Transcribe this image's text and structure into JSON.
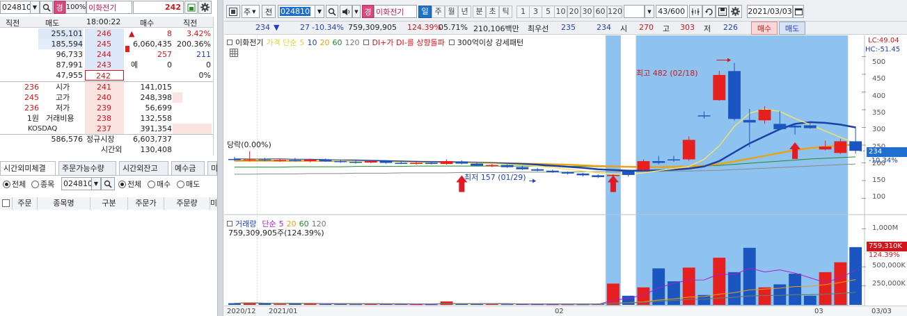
{
  "left_toolbar": {
    "code": "024810",
    "margin_tag": "경",
    "margin_rate": "100%",
    "name": "이화전기",
    "price": "242"
  },
  "orderbook": {
    "headers": [
      "직전",
      "매도",
      "18:00:22",
      "매수",
      "직전"
    ],
    "asks": [
      {
        "prev": "255,101",
        "qty": "255,101",
        "price": "246"
      },
      {
        "prev": "185,594",
        "qty": "185,594",
        "price": "245"
      },
      {
        "prev": "96,733",
        "qty": "96,733",
        "price": "244"
      },
      {
        "prev": "87,991",
        "qty": "87,991",
        "price": "243"
      },
      {
        "prev": "47,955",
        "qty": "47,955",
        "price": "242"
      }
    ],
    "right_info": [
      {
        "a": "▲",
        "b": "8",
        "c": "3.42%"
      },
      {
        "a": "",
        "b": "6,060,435",
        "c": "200.36%"
      },
      {
        "a": "",
        "b": "257",
        "c": "211"
      },
      {
        "a": "예",
        "b": "0",
        "c": "0"
      },
      {
        "a": "",
        "b": "",
        "c": "0%"
      }
    ],
    "bids": [
      {
        "l1": "236",
        "l2": "시가",
        "price": "241",
        "qty": "141,015"
      },
      {
        "l1": "245",
        "l2": "고가",
        "price": "240",
        "qty": "248,398"
      },
      {
        "l1": "236",
        "l2": "저가",
        "price": "239",
        "qty": "56,699"
      },
      {
        "l1": "1원",
        "l2": "거래비용",
        "price": "238",
        "qty": "132,558"
      },
      {
        "l1": "KOSDAQ",
        "l2": "",
        "price": "237",
        "qty": "391,354"
      }
    ],
    "total_ask": "586,576",
    "regular_label": "정규시장",
    "total_bid": "6,603,737",
    "after_label": "시간외",
    "after_qty": "130,408"
  },
  "tabs": [
    "시간외미체결",
    "주문가능수량",
    "시간외잔고",
    "예수금",
    "미"
  ],
  "filter": {
    "opt_all": "전체",
    "opt_stock": "종목",
    "code": "024810",
    "opt_all2": "전체",
    "opt_buy": "매수",
    "opt_sell": "매도"
  },
  "table_headers": [
    "주문",
    "종목명",
    "구분",
    "주문가",
    "주문량",
    "미"
  ],
  "chart_toolbar": {
    "type": "주",
    "prev": "전",
    "code": "024810",
    "margin_tag": "경",
    "name": "이화전기",
    "periods": [
      "일",
      "주",
      "월",
      "년",
      "분",
      "초",
      "틱"
    ],
    "active_period": "일",
    "intervals": [
      "1",
      "3",
      "5",
      "10",
      "20",
      "30",
      "60",
      "120"
    ],
    "count": "43",
    "count_total": "/600",
    "date": "2021/03/03"
  },
  "summary": {
    "price": "234",
    "arrow": "▼",
    "change": "27",
    "change_pct": "-10.34%",
    "volume": "759,309,905",
    "vol_ratio": "124.39%",
    "turnover": "05.71%",
    "amount": "210,106백만",
    "best_label": "최우선",
    "best_ask": "235",
    "best_bid": "234",
    "open_label": "시",
    "open": "270",
    "high_label": "고",
    "high": "303",
    "low_label": "저",
    "low": "226",
    "buy": "매수",
    "sell": "매도"
  },
  "legend": {
    "name": "이화전기",
    "ma_label": "가격 단순",
    "ma_vals": [
      "5",
      "10",
      "20",
      "60",
      "120"
    ],
    "signal": "DI+가 DI-를 상향돌파",
    "pattern": "300억이상 강세패턴"
  },
  "annotations": {
    "upper_limit": "당락(0.00%)",
    "high": "최고 482 (02/18)",
    "low": "최저 157 (01/29)"
  },
  "price_axis": {
    "lc": "LC:49.04",
    "hc": "HC:-51.45",
    "ticks": [
      "500",
      "450",
      "400",
      "350",
      "300",
      "250",
      "200",
      "150",
      "100"
    ],
    "current": "234",
    "current_pct": "-10.34%"
  },
  "volume_legend": {
    "label": "거래량",
    "ma_label": "단순",
    "ma_vals": [
      "5",
      "20",
      "60",
      "120"
    ],
    "info": "759,309,905주(124.39%)"
  },
  "volume_axis": {
    "ticks": [
      "1,000M",
      "500,000K",
      "250,000K"
    ],
    "current": "759,310K",
    "current_pct": "124.39%"
  },
  "x_axis": [
    "2020/12",
    "2021/01",
    "02",
    "03",
    "03/03"
  ],
  "colors": {
    "up": "#e61f1f",
    "down": "#1b56c0",
    "highlight": "#8ec3f0"
  },
  "chart_data": {
    "type": "candlestick",
    "price_ylim": [
      60,
      540
    ],
    "volume_ylim": [
      0,
      1150
    ],
    "candles": [
      {
        "o": 211,
        "h": 217,
        "l": 206,
        "c": 208,
        "v": 22
      },
      {
        "o": 208,
        "h": 233,
        "l": 204,
        "c": 210,
        "v": 30
      },
      {
        "o": 210,
        "h": 214,
        "l": 205,
        "c": 207,
        "v": 18
      },
      {
        "o": 207,
        "h": 211,
        "l": 203,
        "c": 208,
        "v": 12
      },
      {
        "o": 208,
        "h": 214,
        "l": 204,
        "c": 205,
        "v": 14
      },
      {
        "o": 205,
        "h": 212,
        "l": 202,
        "c": 209,
        "v": 20
      },
      {
        "o": 209,
        "h": 212,
        "l": 203,
        "c": 204,
        "v": 10
      },
      {
        "o": 205,
        "h": 208,
        "l": 200,
        "c": 203,
        "v": 9
      },
      {
        "o": 203,
        "h": 206,
        "l": 198,
        "c": 201,
        "v": 8
      },
      {
        "o": 201,
        "h": 207,
        "l": 199,
        "c": 205,
        "v": 12
      },
      {
        "o": 205,
        "h": 208,
        "l": 198,
        "c": 200,
        "v": 10
      },
      {
        "o": 200,
        "h": 205,
        "l": 197,
        "c": 198,
        "v": 9
      },
      {
        "o": 198,
        "h": 202,
        "l": 195,
        "c": 200,
        "v": 8
      },
      {
        "o": 200,
        "h": 204,
        "l": 196,
        "c": 197,
        "v": 7
      },
      {
        "o": 197,
        "h": 210,
        "l": 195,
        "c": 205,
        "v": 45
      },
      {
        "o": 204,
        "h": 207,
        "l": 196,
        "c": 198,
        "v": 12
      },
      {
        "o": 198,
        "h": 201,
        "l": 190,
        "c": 192,
        "v": 10
      },
      {
        "o": 192,
        "h": 197,
        "l": 188,
        "c": 194,
        "v": 9
      },
      {
        "o": 194,
        "h": 196,
        "l": 186,
        "c": 188,
        "v": 8
      },
      {
        "o": 188,
        "h": 191,
        "l": 180,
        "c": 182,
        "v": 9
      },
      {
        "o": 182,
        "h": 186,
        "l": 176,
        "c": 178,
        "v": 8
      },
      {
        "o": 178,
        "h": 181,
        "l": 172,
        "c": 174,
        "v": 7
      },
      {
        "o": 174,
        "h": 176,
        "l": 167,
        "c": 170,
        "v": 7
      },
      {
        "o": 170,
        "h": 172,
        "l": 162,
        "c": 165,
        "v": 7
      },
      {
        "o": 165,
        "h": 168,
        "l": 157,
        "c": 160,
        "v": 8
      },
      {
        "o": 163,
        "h": 168,
        "l": 158,
        "c": 166,
        "v": 280
      },
      {
        "o": 176,
        "h": 181,
        "l": 162,
        "c": 166,
        "v": 120
      },
      {
        "o": 180,
        "h": 210,
        "l": 177,
        "c": 205,
        "v": 230
      },
      {
        "o": 205,
        "h": 220,
        "l": 196,
        "c": 200,
        "v": 480
      },
      {
        "o": 210,
        "h": 220,
        "l": 203,
        "c": 207,
        "v": 310
      },
      {
        "o": 210,
        "h": 275,
        "l": 206,
        "c": 265,
        "v": 490
      },
      {
        "o": 334,
        "h": 345,
        "l": 325,
        "c": 333,
        "v": 130
      },
      {
        "o": 377,
        "h": 460,
        "l": 375,
        "c": 448,
        "v": 620
      },
      {
        "o": 459,
        "h": 482,
        "l": 319,
        "c": 324,
        "v": 430
      },
      {
        "o": 321,
        "h": 352,
        "l": 244,
        "c": 314,
        "v": 750
      },
      {
        "o": 320,
        "h": 360,
        "l": 310,
        "c": 350,
        "v": 230
      },
      {
        "o": 310,
        "h": 346,
        "l": 292,
        "c": 295,
        "v": 270
      },
      {
        "o": 305,
        "h": 312,
        "l": 280,
        "c": 300,
        "v": 410
      },
      {
        "o": 306,
        "h": 312,
        "l": 296,
        "c": 298,
        "v": 120
      },
      {
        "o": 238,
        "h": 263,
        "l": 235,
        "c": 246,
        "v": 430
      },
      {
        "o": 228,
        "h": 268,
        "l": 225,
        "c": 261,
        "v": 560
      },
      {
        "o": 261,
        "h": 303,
        "l": 226,
        "c": 234,
        "v": 759
      }
    ],
    "highlight_ranges": [
      [
        25,
        26
      ],
      [
        27,
        41
      ]
    ],
    "ma5": [
      209,
      210,
      210,
      209,
      208,
      208,
      207,
      206,
      205,
      204,
      203,
      202,
      201,
      200,
      200,
      200,
      199,
      198,
      196,
      194,
      191,
      187,
      182,
      177,
      172,
      169,
      167,
      172,
      178,
      184,
      190,
      210,
      248,
      303,
      340,
      352,
      345,
      325,
      308,
      290,
      272,
      255
    ],
    "ma10": [
      210,
      210,
      210,
      210,
      209,
      209,
      208,
      207,
      207,
      206,
      205,
      204,
      203,
      202,
      202,
      201,
      200,
      199,
      198,
      197,
      195,
      192,
      189,
      186,
      182,
      180,
      178,
      178,
      179,
      181,
      184,
      190,
      205,
      230,
      255,
      275,
      295,
      310,
      315,
      313,
      308,
      300
    ],
    "ma20": [
      206,
      206,
      206,
      206,
      206,
      206,
      206,
      205,
      205,
      205,
      204,
      204,
      203,
      203,
      202,
      202,
      201,
      200,
      199,
      198,
      197,
      196,
      195,
      193,
      191,
      190,
      189,
      188,
      188,
      189,
      190,
      192,
      197,
      204,
      212,
      220,
      228,
      236,
      242,
      246,
      249,
      252
    ],
    "ma60": [
      188,
      188,
      188,
      188,
      189,
      189,
      189,
      189,
      190,
      190,
      190,
      190,
      191,
      191,
      191,
      191,
      191,
      191,
      191,
      191,
      191,
      191,
      190,
      190,
      189,
      189,
      189,
      189,
      189,
      190,
      190,
      191,
      193,
      196,
      199,
      202,
      205,
      208,
      211,
      213,
      215,
      217
    ],
    "ma120": [
      168,
      168,
      169,
      169,
      169,
      170,
      170,
      170,
      171,
      171,
      171,
      172,
      172,
      172,
      172,
      173,
      173,
      173,
      173,
      174,
      174,
      174,
      174,
      175,
      175,
      175,
      176,
      176,
      176,
      177,
      177,
      178,
      179,
      181,
      183,
      185,
      187,
      189,
      191,
      193,
      195,
      197
    ]
  }
}
